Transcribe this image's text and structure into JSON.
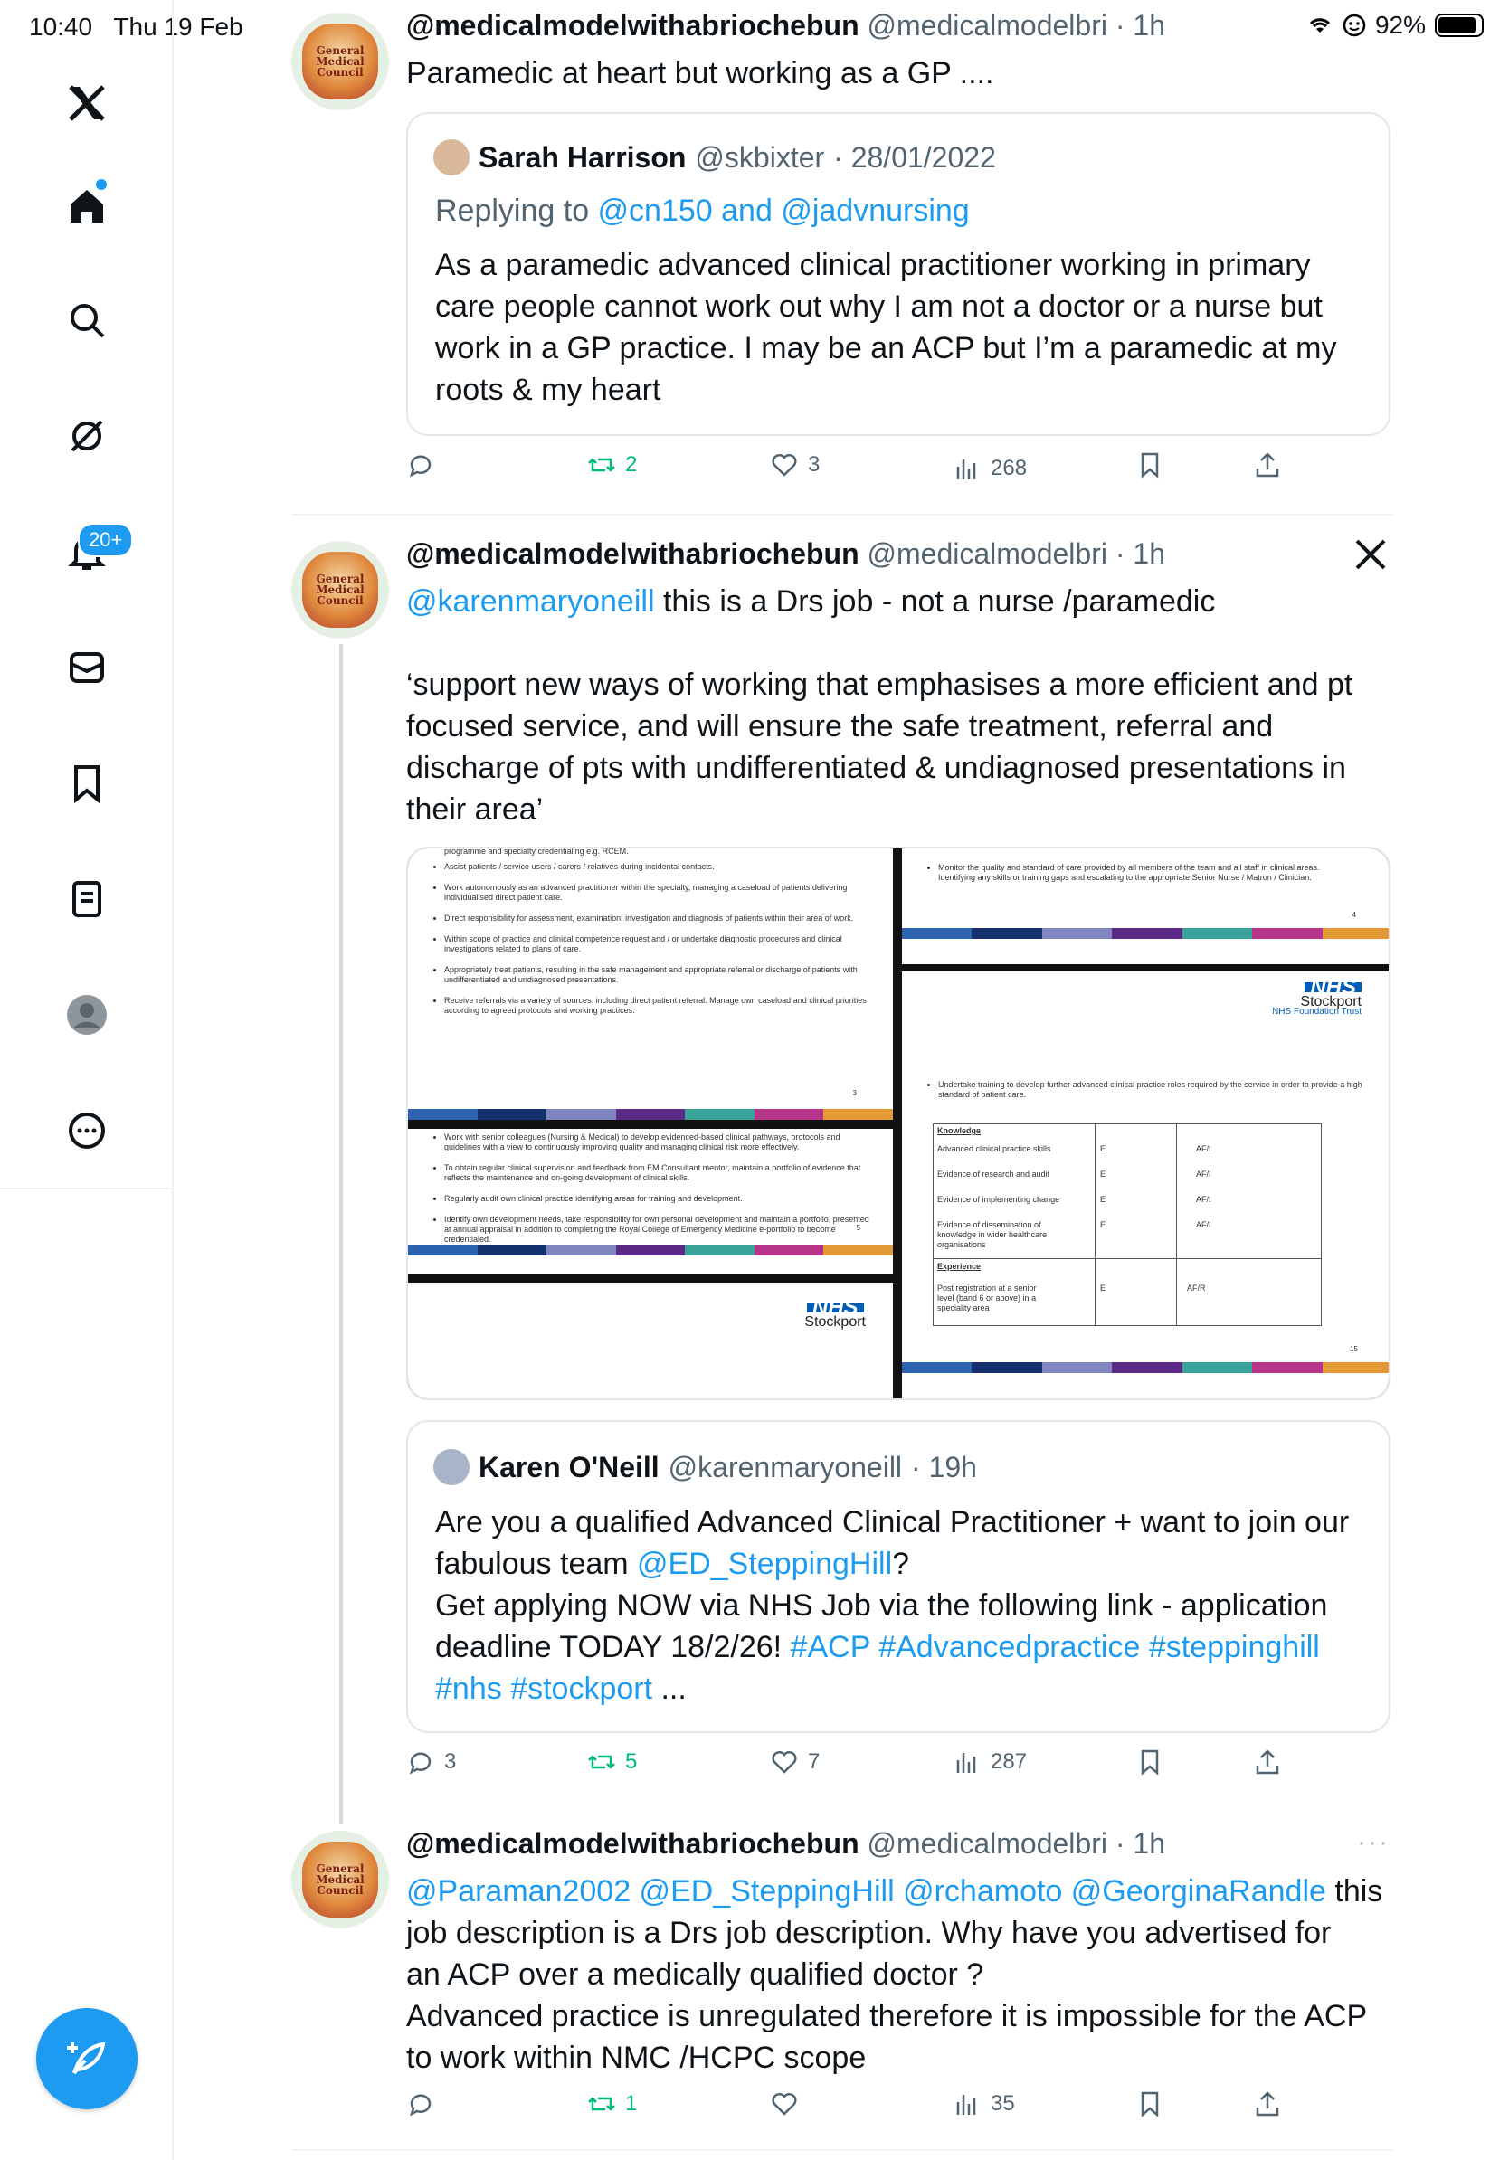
{
  "status": {
    "time": "10:40",
    "date": "Thu 19 Feb",
    "battery": "92%"
  },
  "sidebar": {
    "notifications_badge": "20+"
  },
  "tweet1": {
    "name": "@medicalmodelwithabriochebun",
    "handle": "@medicalmodelbri",
    "time": "· 1h",
    "text": "Paramedic at heart but working as a GP ....",
    "quote": {
      "name": "Sarah Harrison",
      "handle": "@skbixter",
      "date": "· 28/01/2022",
      "replying_prefix": "Replying to ",
      "replying_users": "@cn150 and @jadvnursing",
      "text": "As a paramedic advanced clinical practitioner working in primary care people cannot work out why I am not a doctor or a nurse but work in a GP practice. I may be an ACP but I’m a paramedic at my roots & my heart"
    },
    "stats": {
      "replies": "",
      "retweets": "2",
      "likes": "3",
      "views": "268"
    }
  },
  "tweet2": {
    "name": "@medicalmodelwithabriochebun",
    "handle": "@medicalmodelbri",
    "time": "· 1h",
    "mention": "@karenmaryoneill",
    "text1": " this is a Drs job - not a nurse /paramedic",
    "text2": "‘support new ways of working that emphasises a more efficient and pt focused service, and will ensure the safe treatment, referral and discharge of pts with undifferentiated & undiagnosed presentations in their area’",
    "media": {
      "p1_top": "programme and specialty credentialing e.g. RCEM.",
      "p1_items": [
        "Assist patients / service users / carers / relatives during incidental contacts.",
        "Work autonomously as an advanced practitioner within the specialty, managing a caseload of patients delivering individualised direct patient care.",
        "Direct responsibility for assessment, examination, investigation and diagnosis of patients within their area of work.",
        "Within scope of practice and clinical competence request and / or undertake diagnostic procedures and clinical investigations related to plans of care.",
        "Appropriately treat patients, resulting in the safe management and appropriate referral or discharge of patients with undifferentiated and undiagnosed presentations.",
        "Receive referrals via a variety of sources, including direct patient referral. Manage own caseload and clinical priorities according to agreed protocols and working practices."
      ],
      "p1_num": "3",
      "p2_text": "Monitor the quality and standard of care provided by all members of the team and all staff in clinical areas. Identifying any skills or training gaps and escalating to the appropriate Senior Nurse / Matron / Clinician.",
      "p2_num": "4",
      "p3_items": [
        "Work with senior colleagues (Nursing & Medical) to develop evidenced-based clinical pathways, protocols and guidelines with a view to continuously improving quality and managing clinical risk more effectively.",
        "To obtain regular clinical supervision and feedback from EM Consultant mentor, maintain a portfolio of evidence that reflects the maintenance and on-going development of clinical skills.",
        "Regularly audit own clinical practice identifying areas for training and development.",
        "Identify own development needs, take responsibility for own personal development and maintain a portfolio, presented at annual appraisal in addition to completing the Royal College of Emergency Medicine e-portfolio to become credentialed."
      ],
      "p3_num": "5",
      "nhs_logo": "NHS",
      "nhs_place": "Stockport",
      "nhs_trust": "NHS Foundation Trust",
      "p4_text": "Undertake training to develop further advanced clinical practice roles required by the service in order to provide a high standard of patient care.",
      "knowledge_title": "Knowledge",
      "knowledge_rows": [
        {
          "label": "Advanced clinical practice skills",
          "e": "E",
          "af": "AF/I"
        },
        {
          "label": "Evidence of research and audit",
          "e": "E",
          "af": "AF/I"
        },
        {
          "label": "Evidence of implementing change",
          "e": "E",
          "af": "AF/I"
        },
        {
          "label": "Evidence of dissemination of knowledge in wider healthcare organisations",
          "e": "E",
          "af": "AF/I"
        }
      ],
      "experience_title": "Experience",
      "experience_row": {
        "label": "Post registration at a senior level (band 6 or above) in a speciality area",
        "e": "E",
        "af": "AF/R"
      },
      "p4_num": "15",
      "stripe_colors": [
        "#2c63b0",
        "#14306e",
        "#7e86bd",
        "#5b2a86",
        "#3aa39a",
        "#b6358a",
        "#e39a36"
      ]
    },
    "quote": {
      "name": "Karen O'Neill",
      "handle": "@karenmaryoneill",
      "time": "· 19h",
      "line1": "Are you a qualified Advanced Clinical Practitioner + want to join our",
      "line2_text": "fabulous team ",
      "line2_link": "@ED_SteppingHill",
      "line2_end": "?",
      "line3": "Get applying NOW via NHS Job via the following link - application",
      "line4_text": "deadline TODAY 18/2/26! ",
      "line4_tags": "#ACP #Advancedpractice #steppinghill",
      "line5_tags": "#nhs #stockport",
      "line5_end": " ..."
    },
    "stats": {
      "replies": "3",
      "retweets": "5",
      "likes": "7",
      "views": "287"
    }
  },
  "tweet3": {
    "name": "@medicalmodelwithabriochebun",
    "handle": "@medicalmodelbri",
    "time": "· 1h",
    "mentions": "@Paraman2002 @ED_SteppingHill @rchamoto @GeorginaRandle",
    "line1_end": " this",
    "line2": "job description is a Drs job description. Why have you advertised for",
    "line3": "an ACP over a medically qualified doctor ?",
    "line4": "Advanced practice is unregulated therefore it is impossible for the ACP",
    "line5": "to work within NMC /HCPC scope",
    "stats": {
      "replies": "",
      "retweets": "1",
      "likes": "",
      "views": "35"
    }
  },
  "colors": {
    "accent": "#1d9bf0",
    "retweet": "#00ba7c",
    "muted": "#536471"
  }
}
